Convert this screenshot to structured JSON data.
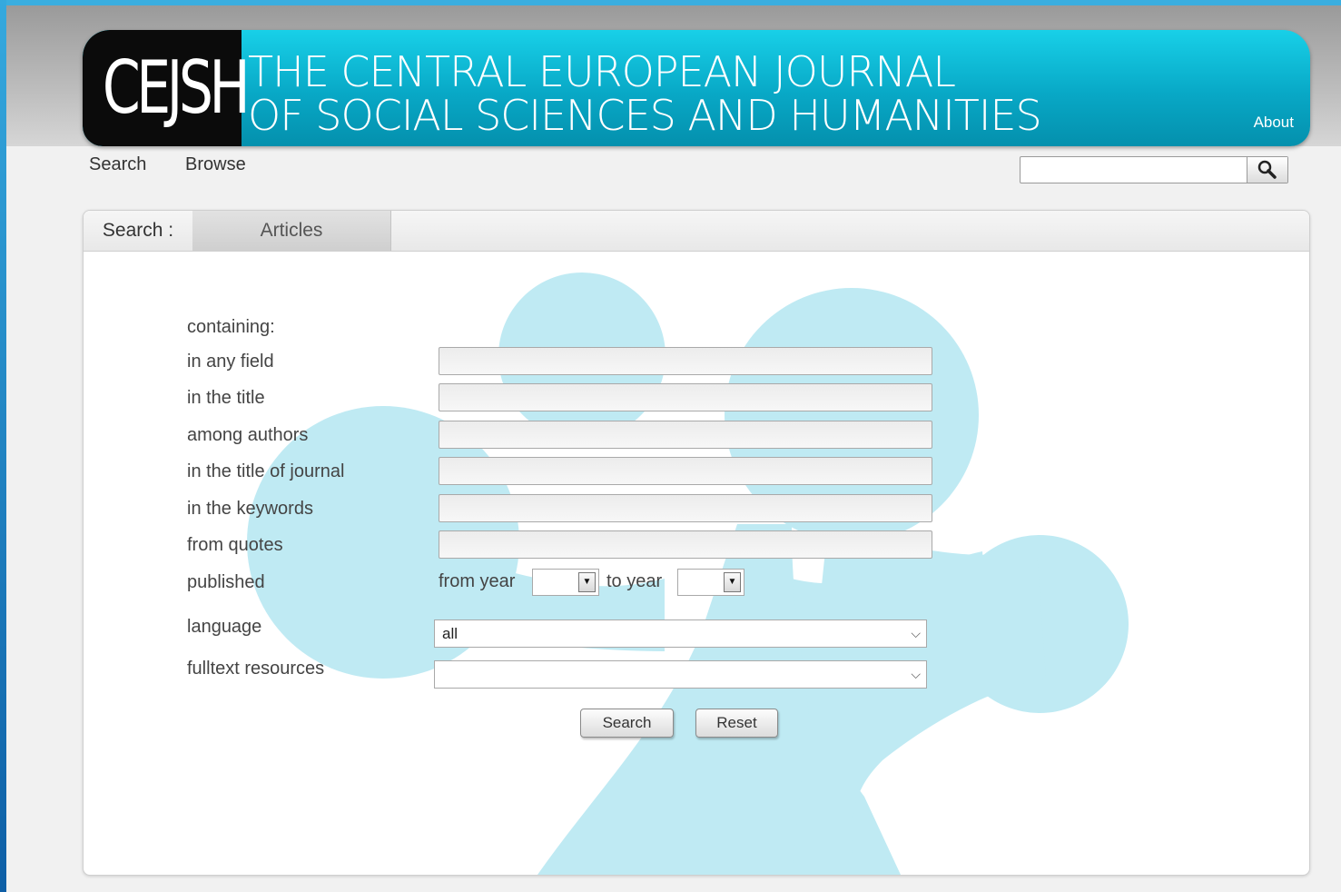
{
  "brand": {
    "logo": "CEJSH",
    "title_line1": "THE CENTRAL EUROPEAN JOURNAL",
    "title_line2": "OF SOCIAL SCIENCES AND HUMANITIES",
    "about": "About"
  },
  "nav": {
    "search": "Search",
    "browse": "Browse"
  },
  "site_search": {
    "value": "",
    "icon": "search-icon"
  },
  "tabs": {
    "label": "Search :",
    "articles": "Articles"
  },
  "form": {
    "containing": "containing:",
    "any_field": "in any field",
    "title": "in the title",
    "authors": "among authors",
    "journal": "in the title of journal",
    "keywords": "in the keywords",
    "quotes": "from quotes",
    "published": "published",
    "from_year": "from year",
    "to_year": "to year",
    "from_year_value": "",
    "to_year_value": "",
    "language": "language",
    "language_value": "all",
    "fulltext": "fulltext resources",
    "fulltext_value": "",
    "search_button": "Search",
    "reset_button": "Reset"
  },
  "colors": {
    "banner": "#08a8c6",
    "shape": "#bfeaf3"
  }
}
